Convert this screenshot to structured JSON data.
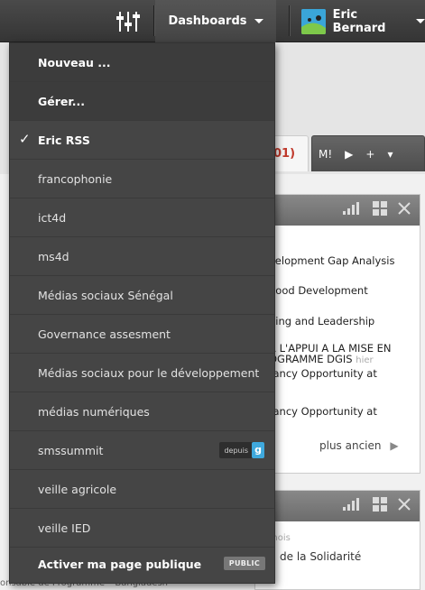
{
  "topbar": {
    "dashboards_label": "Dashboards",
    "user_name": "Eric Bernard"
  },
  "menu": {
    "new_label": "Nouveau ...",
    "manage_label": "Gérer...",
    "checked_item": "Eric RSS",
    "items": [
      "francophonie",
      "ict4d",
      "ms4d",
      "Médias sociaux Sénégal",
      "Governance assesment",
      "Médias sociaux pour le développement",
      "médias numériques",
      "smssummit",
      "veille agricole",
      "veille IED"
    ],
    "smssummit_badge": "depuis",
    "smssummit_badge_letter": "g",
    "public_page_label": "Activer ma page publique",
    "public_badge": "PUBLIC"
  },
  "background": {
    "tab_red": "01)",
    "tab_dark": "M!",
    "panel1_lines": [
      "velopment Gap Analysis",
      "hood Development",
      "ding and Leadership",
      "R L'APPUI A LA MISE EN",
      "OGRAMME DGIS",
      "tancy Opportunity at",
      "tancy Opportunity at"
    ],
    "panel1_ago": "hier",
    "more_label": "plus ancien",
    "panel2_meta": "mois",
    "panel2_line": "de la Solidarité",
    "bottom_fragment": "onsable de Programme – Bangladesh"
  },
  "colors": {
    "topbar": "#3d3d3d",
    "menu_bg": "#454545",
    "accent_blue": "#3aa5d8",
    "tab_red": "#c0392b"
  }
}
